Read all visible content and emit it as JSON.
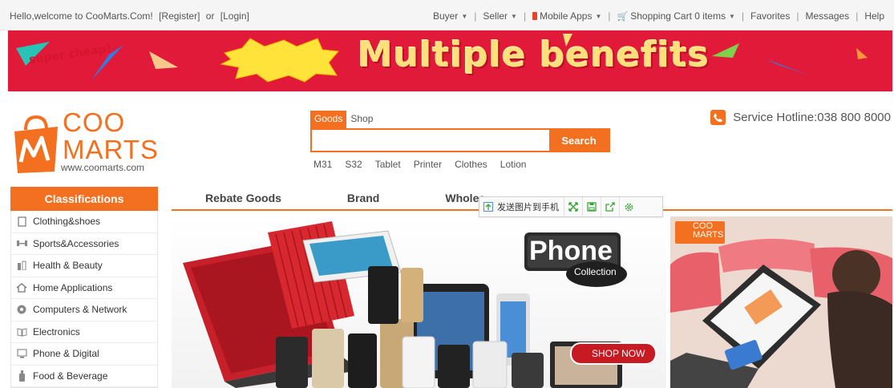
{
  "topbar": {
    "welcome": "Hello,welcome to CooMarts.Com!",
    "register": "[Register]",
    "or": "or",
    "login": "[Login]",
    "nav": {
      "buyer": "Buyer",
      "seller": "Seller",
      "mobile_apps": "Mobile Apps",
      "cart": "Shopping Cart 0 items",
      "favorites": "Favorites",
      "messages": "Messages",
      "help": "Help"
    }
  },
  "banner": {
    "tag": "super cheap!",
    "headline": "Multiple benefits",
    "bg_color": "#e21a39"
  },
  "logo": {
    "line1": "COO",
    "line2": "MARTS",
    "url": "www.coomarts.com",
    "color": "#f37021"
  },
  "search": {
    "tabs": [
      "Goods",
      "Shop"
    ],
    "active_tab": "Goods",
    "value": "",
    "button": "Search",
    "hot_keywords": [
      "M31",
      "S32",
      "Tablet",
      "Printer",
      "Clothes",
      "Lotion"
    ]
  },
  "hotline": {
    "text": "Service Hotline:038 800 8000"
  },
  "classifications": {
    "title": "Classifications",
    "items": [
      {
        "label": "Clothing&shoes",
        "icon": "shirt-icon"
      },
      {
        "label": "Sports&Accessories",
        "icon": "dumbbell-icon"
      },
      {
        "label": "Health & Beauty",
        "icon": "cosmetics-icon"
      },
      {
        "label": "Home Applications",
        "icon": "home-icon"
      },
      {
        "label": "Computers & Network",
        "icon": "network-icon"
      },
      {
        "label": "Electronics",
        "icon": "book-icon"
      },
      {
        "label": "Phone & Digital",
        "icon": "monitor-icon"
      },
      {
        "label": "Food & Beverage",
        "icon": "bottle-icon"
      }
    ]
  },
  "main_nav": {
    "items": [
      "Rebate Goods",
      "Brand",
      "Wholes"
    ]
  },
  "hero": {
    "title": "Phone",
    "subtitle": "Collection",
    "cta": "SHOP NOW"
  },
  "side_ad": {
    "logo_line1": "COO",
    "logo_line2": "MARTS"
  },
  "floatbar": {
    "send_label": "发送图片到手机",
    "tools": [
      "expand-icon",
      "save-icon",
      "share-icon",
      "settings-icon"
    ]
  },
  "colors": {
    "accent": "#f37021",
    "banner": "#e21a39",
    "float_green": "#3aa63a"
  }
}
